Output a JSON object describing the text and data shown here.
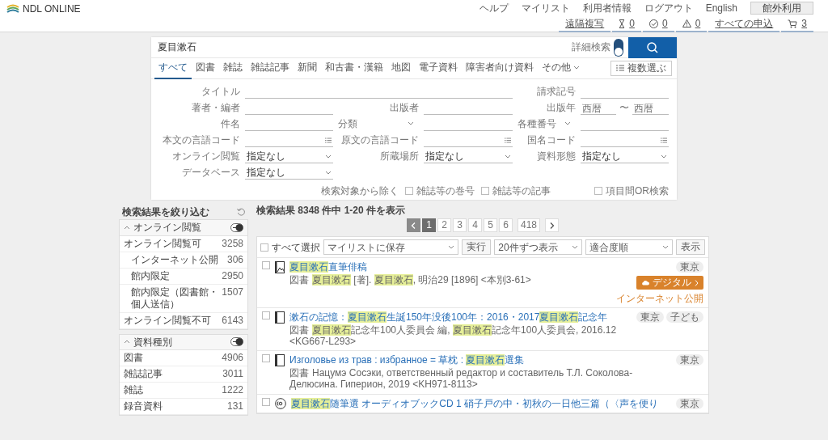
{
  "header": {
    "logo": "NDL ONLINE",
    "links": [
      "ヘルプ",
      "マイリスト",
      "利用者情報",
      "ログアウト",
      "English"
    ],
    "outside_button": "館外利用",
    "status": [
      {
        "kind": "text",
        "label": "遠隔複写"
      },
      {
        "kind": "hourglass",
        "label": "0"
      },
      {
        "kind": "check",
        "label": "0"
      },
      {
        "kind": "warning",
        "label": "0"
      },
      {
        "kind": "text",
        "label": "すべての申込"
      },
      {
        "kind": "cart",
        "label": "3"
      }
    ]
  },
  "search": {
    "value": "夏目漱石",
    "advanced_label": "詳細検索",
    "advanced_on": true
  },
  "tabs": [
    {
      "label": "すべて",
      "selected": true,
      "kind": "plain"
    },
    {
      "label": "図書",
      "selected": false,
      "kind": "plain"
    },
    {
      "label": "雑誌",
      "selected": false,
      "kind": "plain"
    },
    {
      "label": "雑誌記事",
      "selected": false,
      "kind": "plain"
    },
    {
      "label": "新聞",
      "selected": false,
      "kind": "plain"
    },
    {
      "label": "和古書・漢籍",
      "selected": false,
      "kind": "plain"
    },
    {
      "label": "地図",
      "selected": false,
      "kind": "plain"
    },
    {
      "label": "電子資料",
      "selected": false,
      "kind": "plain"
    },
    {
      "label": "障害者向け資料",
      "selected": false,
      "kind": "plain"
    },
    {
      "label": "その他",
      "selected": false,
      "kind": "dropdown"
    }
  ],
  "multi_select_button": "複数選ぶ",
  "form": {
    "rows": [
      [
        {
          "kind": "text",
          "label": "タイトル"
        },
        "",
        {
          "kind": "text",
          "label": "請求記号"
        }
      ],
      [
        {
          "kind": "text",
          "label": "著者・編者"
        },
        {
          "kind": "text",
          "label": "出版者"
        },
        {
          "kind": "range",
          "label": "出版年",
          "from_placeholder": "西暦",
          "separator": "〜",
          "to_placeholder": "西暦"
        }
      ],
      [
        {
          "kind": "text",
          "label": "件名"
        },
        {
          "kind": "label-select",
          "label": "分類"
        },
        {
          "kind": "label-select",
          "label": "各種番号"
        }
      ],
      [
        {
          "kind": "code",
          "label": "本文の言語コード"
        },
        {
          "kind": "code",
          "label": "原文の言語コード"
        },
        {
          "kind": "code",
          "label": "国名コード"
        }
      ],
      [
        {
          "kind": "select",
          "label": "オンライン閲覧",
          "value": "指定なし"
        },
        {
          "kind": "select",
          "label": "所蔵場所",
          "value": "指定なし"
        },
        {
          "kind": "select",
          "label": "資料形態",
          "value": "指定なし"
        }
      ],
      [
        {
          "kind": "select",
          "label": "データベース",
          "value": "指定なし"
        }
      ]
    ],
    "exclude_label": "検索対象から除く",
    "exclude_options": [
      {
        "label": "雑誌等の巻号",
        "checked": false
      },
      {
        "label": "雑誌等の記事",
        "checked": false
      }
    ],
    "or_search": {
      "label": "項目間OR検索",
      "checked": false
    }
  },
  "sidebar": {
    "title": "検索結果を絞り込む",
    "facets": [
      {
        "title": "オンライン閲覧",
        "expanded": true,
        "items": [
          {
            "label": "オンライン閲覧可",
            "count": "3258",
            "children": [
              {
                "label": "インターネット公開",
                "count": "306"
              },
              {
                "label": "館内限定",
                "count": "2950"
              },
              {
                "label": "館内限定（図書館・個人送信）",
                "count": "1507"
              }
            ]
          },
          {
            "label": "オンライン閲覧不可",
            "count": "6143"
          }
        ]
      },
      {
        "title": "資料種別",
        "expanded": true,
        "items": [
          {
            "label": "図書",
            "count": "4906"
          },
          {
            "label": "雑誌記事",
            "count": "3011"
          },
          {
            "label": "雑誌",
            "count": "1222"
          },
          {
            "label": "録音資料",
            "count": "131"
          }
        ]
      }
    ]
  },
  "results": {
    "summary": "検索結果 8348 件中 1-20 件を表示",
    "pages": [
      {
        "label": "1",
        "selected": true
      },
      {
        "label": "2",
        "selected": false
      },
      {
        "label": "3",
        "selected": false
      },
      {
        "label": "4",
        "selected": false
      },
      {
        "label": "5",
        "selected": false
      },
      {
        "label": "6",
        "selected": false
      },
      {
        "label": "418",
        "selected": false
      }
    ],
    "toolbar": {
      "select_all": {
        "label": "すべて選択",
        "checked": false
      },
      "action": "マイリストに保存",
      "run_button": "実行",
      "per_page": "20件ずつ表示",
      "sort": "適合度順",
      "show_button": "表示"
    },
    "items": [
      {
        "kind": "picture",
        "checked": false,
        "title": [
          {
            "text": "夏目漱石",
            "highlighted": true
          },
          {
            "text": "直筆俳稿",
            "highlighted": false
          }
        ],
        "type": "図書",
        "meta": [
          {
            "text": "夏目漱石",
            "highlighted": true
          },
          {
            "text": " [著]. ",
            "highlighted": false
          },
          {
            "text": "夏目漱石",
            "highlighted": true
          },
          {
            "text": ", 明治29 [1896] <本別3-61>",
            "highlighted": false
          }
        ],
        "tags": [
          "東京"
        ],
        "digital": {
          "label": "デジタル",
          "note": "インターネット公開"
        }
      },
      {
        "kind": "book",
        "checked": false,
        "title": [
          {
            "text": "漱石の記憶：",
            "highlighted": false
          },
          {
            "text": "夏目漱石",
            "highlighted": true
          },
          {
            "text": "生誕150年没後100年：2016・2017",
            "highlighted": false
          },
          {
            "text": "夏目漱石",
            "highlighted": true
          },
          {
            "text": "記念年",
            "highlighted": false
          }
        ],
        "type": "図書",
        "meta": [
          {
            "text": "夏目漱石",
            "highlighted": true
          },
          {
            "text": "記念年100人委員会 編, ",
            "highlighted": false
          },
          {
            "text": "夏目漱石",
            "highlighted": true
          },
          {
            "text": "記念年100人委員会, 2016.12 <KG667-L293>",
            "highlighted": false
          }
        ],
        "tags": [
          "東京",
          "子ども"
        ]
      },
      {
        "kind": "book",
        "checked": false,
        "title": [
          {
            "text": "Изголовье из трав : избранное = 草枕 : ",
            "highlighted": false
          },
          {
            "text": "夏目漱石",
            "highlighted": true
          },
          {
            "text": "選集",
            "highlighted": false
          }
        ],
        "type": "図書",
        "meta": [
          {
            "text": "Нацумэ Сосэки, ответственный редактор и составитель Т.Л. Соколова-Делюсина. Гиперион, 2019 <KH971-8113>",
            "highlighted": false
          }
        ],
        "tags": [
          "東京"
        ]
      },
      {
        "kind": "audio",
        "checked": false,
        "title": [
          {
            "text": "夏目漱石",
            "highlighted": true
          },
          {
            "text": "随筆選 オーディオブックCD 1 硝子戸の中・初秋の一日他三篇（〈声を便り",
            "highlighted": false
          }
        ],
        "tags": [
          "東京"
        ]
      }
    ]
  }
}
